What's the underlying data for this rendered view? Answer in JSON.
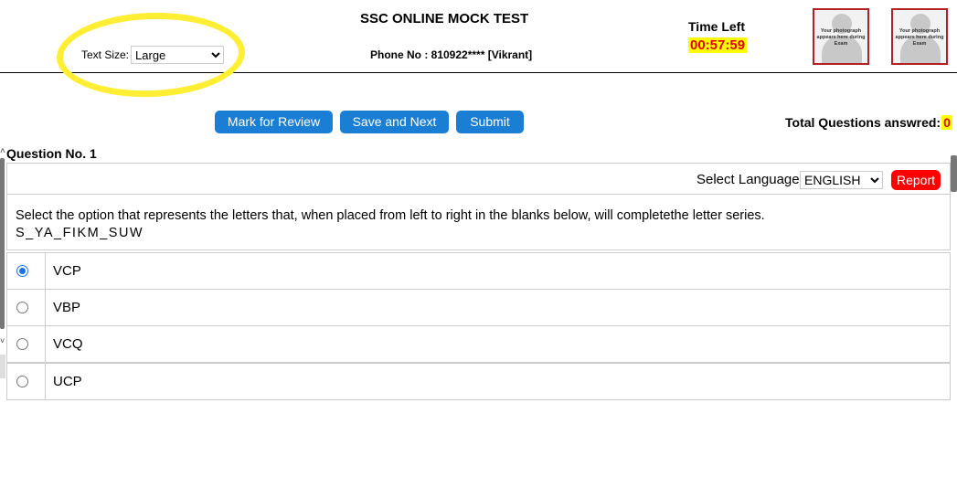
{
  "header": {
    "text_size_label": "Text Size:",
    "text_size_value": "Large",
    "title": "SSC ONLINE MOCK TEST",
    "phone": "Phone No : 810922**** [Vikrant]",
    "time_left_label": "Time Left",
    "time_left_value": "00:57:59",
    "photo_caption_1": "Your photograph appears here during Exam",
    "photo_caption_2": "Your photograph appears here during Exam"
  },
  "toolbar": {
    "mark_review_label": "Mark for Review",
    "save_next_label": "Save and Next",
    "submit_label": "Submit",
    "answered_label": "Total Questions answred:",
    "answered_count": "0"
  },
  "question": {
    "number_label": "Question No. 1",
    "language_label": "Select Language:",
    "language_value": "ENGLISH",
    "report_label": "Report",
    "text": "Select the option that represents the letters that, when placed from left to right in the blanks below, will completethe letter series.",
    "series": "S_YA_FIKM_SUW"
  },
  "options": [
    {
      "label": "VCP",
      "selected": true
    },
    {
      "label": "VBP",
      "selected": false
    },
    {
      "label": "VCQ",
      "selected": false
    },
    {
      "label": "UCP",
      "selected": false
    }
  ],
  "colors": {
    "button_blue": "#1a7fd4",
    "report_red": "#ff0000",
    "highlight_yellow": "#ffff00",
    "annotation_yellow": "#ffee33"
  }
}
